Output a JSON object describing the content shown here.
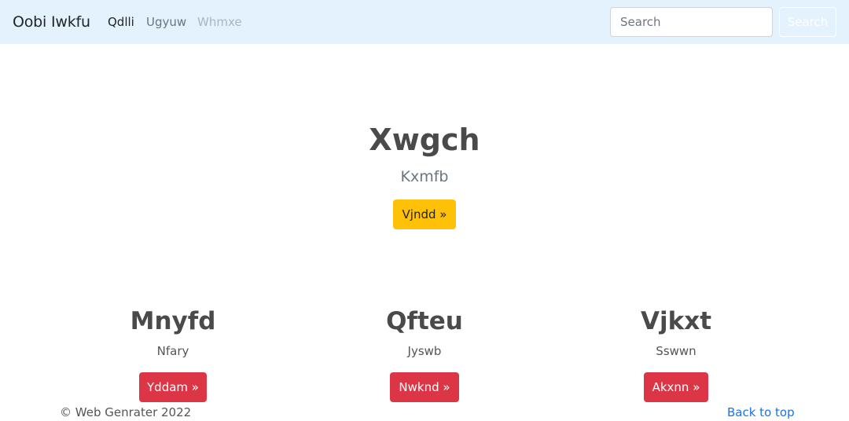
{
  "navbar": {
    "brand": "Oobi Iwkfu",
    "links": [
      {
        "label": "Qdlli",
        "state": "active"
      },
      {
        "label": "Ugyuw",
        "state": "normal"
      },
      {
        "label": "Whmxe",
        "state": "disabled"
      }
    ],
    "search": {
      "placeholder": "Search",
      "value": "",
      "button_label": "Search"
    }
  },
  "hero": {
    "title": "Xwgch",
    "subtitle": "Kxmfb",
    "button_label": "Vjndd »"
  },
  "columns": [
    {
      "title": "Mnyfd",
      "text": "Nfary",
      "button_label": "Yddam »"
    },
    {
      "title": "Qfteu",
      "text": "Jyswb",
      "button_label": "Nwknd »"
    },
    {
      "title": "Vjkxt",
      "text": "Sswwn",
      "button_label": "Akxnn »"
    }
  ],
  "footer": {
    "copyright": "© Web Genrater 2022",
    "back_to_top": "Back to top"
  },
  "colors": {
    "navbar_bg": "#e3f2fd",
    "warning": "#ffc107",
    "danger": "#dc3545",
    "link": "#1a73e8"
  }
}
